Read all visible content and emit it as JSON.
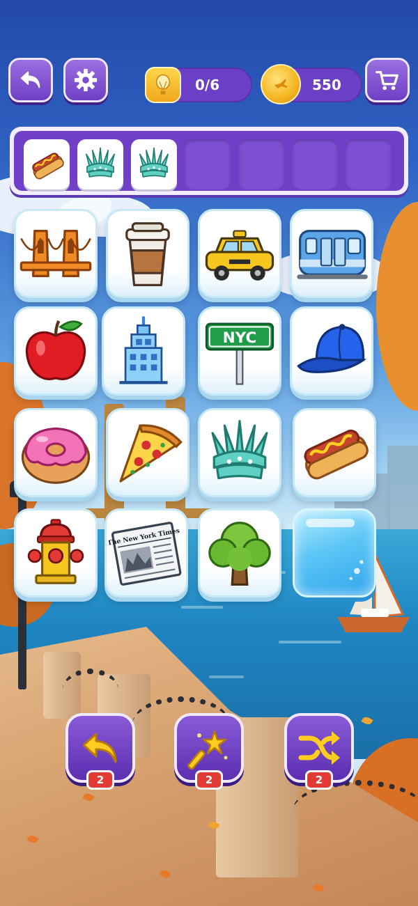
{
  "header": {
    "back_icon": "back-arrow-icon",
    "settings_icon": "gear-icon",
    "goal": {
      "icon": "hot-air-balloon-icon",
      "text": "0/6"
    },
    "coins": {
      "icon": "coin-icon",
      "text": "550"
    },
    "shop_icon": "cart-icon"
  },
  "tray": {
    "capacity": 7,
    "slots": [
      {
        "item": "hot-dog"
      },
      {
        "item": "statue-of-liberty-crown"
      },
      {
        "item": "statue-of-liberty-crown"
      },
      {
        "item": null
      },
      {
        "item": null
      },
      {
        "item": null
      },
      {
        "item": null
      }
    ]
  },
  "board": {
    "rows": [
      [
        "brooklyn-bridge",
        "coffee-cup",
        "taxi",
        "subway-train"
      ],
      [
        "apple",
        "skyscraper",
        "nyc-sign",
        "baseball-cap"
      ],
      [
        "donut",
        "pizza-slice",
        "statue-of-liberty-crown",
        "hot-dog"
      ],
      [
        "fire-hydrant",
        "newspaper",
        "tree",
        "ice-block"
      ]
    ],
    "nyc_sign_text": "NYC",
    "newspaper_text": "The New York Times"
  },
  "boosters": [
    {
      "name": "undo",
      "icon": "undo-arrow-icon",
      "count": "2"
    },
    {
      "name": "magic-wand",
      "icon": "magic-wand-icon",
      "count": "2"
    },
    {
      "name": "shuffle",
      "icon": "shuffle-icon",
      "count": "2"
    }
  ],
  "colors": {
    "panel_purple": "#6f40c7",
    "badge_red": "#e23b35",
    "tile_white": "#ffffff",
    "coin_gold": "#f5b521"
  }
}
